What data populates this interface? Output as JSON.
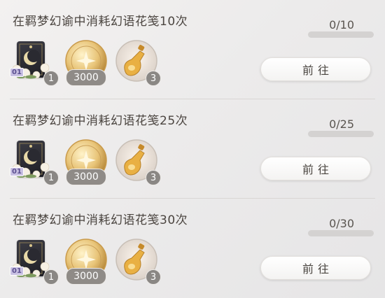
{
  "tasks": [
    {
      "title": "在羁梦幻谕中消耗幻语花笺10次",
      "progress_text": "0/10",
      "progress_ratio": 0,
      "rewards": [
        {
          "icon": "moon-card-icon",
          "tag": "01",
          "count": "1"
        },
        {
          "icon": "gold-coin-icon",
          "count": "3000"
        },
        {
          "icon": "potion-bottle-icon",
          "count": "3"
        }
      ],
      "button_label": "前往"
    },
    {
      "title": "在羁梦幻谕中消耗幻语花笺25次",
      "progress_text": "0/25",
      "progress_ratio": 0,
      "rewards": [
        {
          "icon": "moon-card-icon",
          "tag": "01",
          "count": "1"
        },
        {
          "icon": "gold-coin-icon",
          "count": "3000"
        },
        {
          "icon": "potion-bottle-icon",
          "count": "3"
        }
      ],
      "button_label": "前往"
    },
    {
      "title": "在羁梦幻谕中消耗幻语花笺30次",
      "progress_text": "0/30",
      "progress_ratio": 0,
      "rewards": [
        {
          "icon": "moon-card-icon",
          "tag": "01",
          "count": "1"
        },
        {
          "icon": "gold-coin-icon",
          "count": "3000"
        },
        {
          "icon": "potion-bottle-icon",
          "count": "3"
        }
      ],
      "button_label": "前往"
    }
  ]
}
